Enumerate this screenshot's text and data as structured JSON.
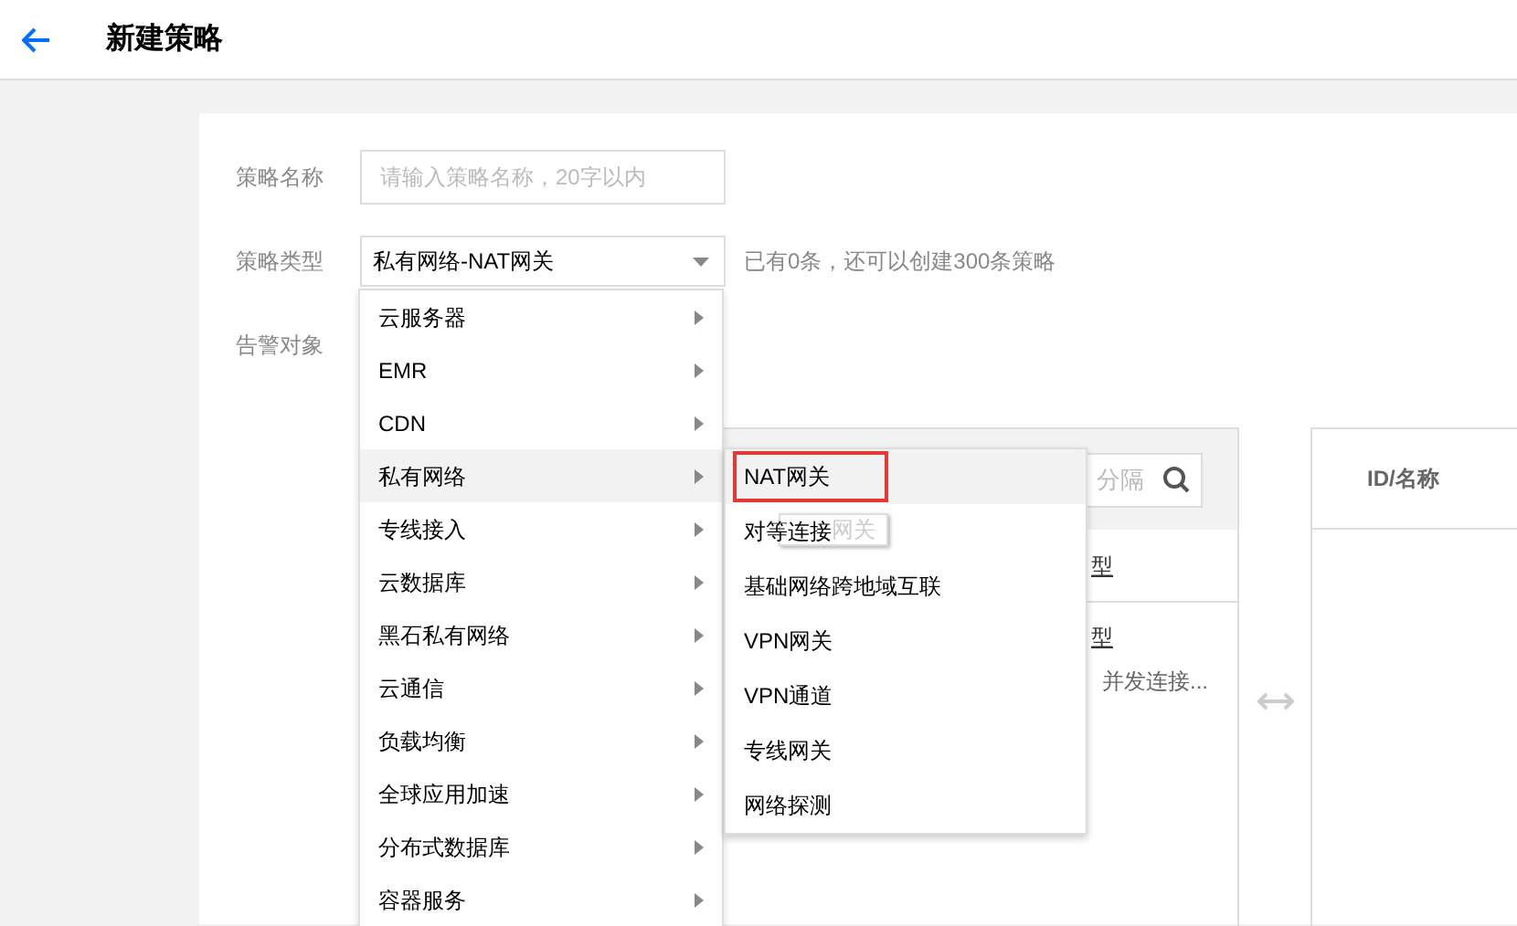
{
  "header": {
    "title": "新建策略"
  },
  "fields": [
    {
      "kind": "input",
      "label": "策略名称",
      "placeholder": "请输入策略名称，20字以内"
    },
    {
      "kind": "select",
      "label": "策略类型",
      "value": "私有网络-NAT网关",
      "hint": "已有0条，还可以创建300条策略"
    },
    {
      "kind": "transfer",
      "label": "告警对象"
    }
  ],
  "transfer": {
    "left": {
      "search_placeholder": "分隔",
      "column_header": "型",
      "rows": [
        {
          "title": "型",
          "description": "并发连接..."
        }
      ]
    },
    "right": {
      "column_header": "ID/名称"
    }
  },
  "menu": {
    "items": [
      {
        "label": "云服务器",
        "selected": false
      },
      {
        "label": "EMR",
        "selected": false
      },
      {
        "label": "CDN",
        "selected": false
      },
      {
        "label": "私有网络",
        "selected": true
      },
      {
        "label": "专线接入",
        "selected": false
      },
      {
        "label": "云数据库",
        "selected": false
      },
      {
        "label": "黑石私有网络",
        "selected": false
      },
      {
        "label": "云通信",
        "selected": false
      },
      {
        "label": "负载均衡",
        "selected": false
      },
      {
        "label": "全球应用加速",
        "selected": false
      },
      {
        "label": "分布式数据库",
        "selected": false
      },
      {
        "label": "容器服务",
        "selected": false
      }
    ]
  },
  "submenu": {
    "items": [
      {
        "label": "NAT网关",
        "selected": true
      },
      {
        "label": "对等连接",
        "selected": false
      },
      {
        "label": "基础网络跨地域互联",
        "selected": false
      },
      {
        "label": "VPN网关",
        "selected": false
      },
      {
        "label": "VPN通道",
        "selected": false
      },
      {
        "label": "专线网关",
        "selected": false
      },
      {
        "label": "网络探测",
        "selected": false
      }
    ]
  },
  "tooltip": {
    "text": "网关"
  }
}
